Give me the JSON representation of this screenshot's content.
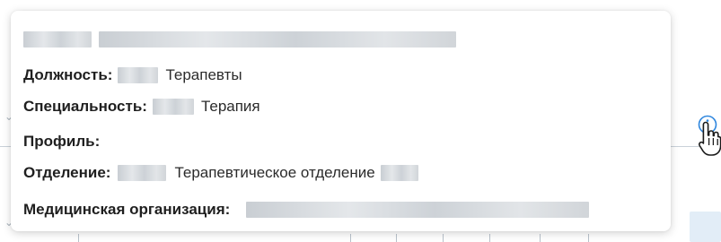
{
  "tooltip": {
    "position_label": "Должность:",
    "position_value": "Терапевты",
    "specialty_label": "Специальность:",
    "specialty_value": "Терапия",
    "profile_label": "Профиль:",
    "department_label": "Отделение:",
    "department_value": "Терапевтическое отделение",
    "organization_label": "Медицинская организация:"
  },
  "icons": {
    "info": "info-icon",
    "cursor": "hand-pointer-icon"
  },
  "colors": {
    "info_accent": "#2e86de",
    "text": "#222222"
  }
}
